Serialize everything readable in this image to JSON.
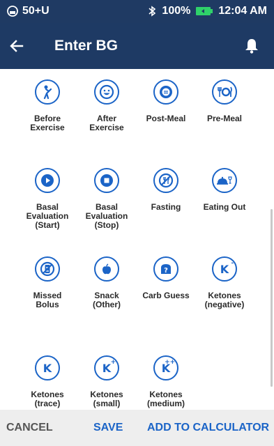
{
  "status_bar": {
    "carrier": "50+U",
    "battery_percent": "100%",
    "time": "12:04 AM"
  },
  "header": {
    "title": "Enter BG"
  },
  "tags": [
    {
      "label": "Before\nExercise",
      "icon": "exercise-icon"
    },
    {
      "label": "After\nExercise",
      "icon": "happy-face-icon"
    },
    {
      "label": "Post-Meal",
      "icon": "empty-plate-icon"
    },
    {
      "label": "Pre-Meal",
      "icon": "utensils-plate-icon"
    },
    {
      "label": "Basal\nEvaluation\n(Start)",
      "icon": "play-icon"
    },
    {
      "label": "Basal\nEvaluation\n(Stop)",
      "icon": "stop-icon"
    },
    {
      "label": "Fasting",
      "icon": "no-food-icon"
    },
    {
      "label": "Eating Out",
      "icon": "cloche-glass-icon"
    },
    {
      "label": "Missed\nBolus",
      "icon": "missed-bolus-icon"
    },
    {
      "label": "Snack\n(Other)",
      "icon": "apple-icon"
    },
    {
      "label": "Carb Guess",
      "icon": "bread-question-icon"
    },
    {
      "label": "Ketones\n(negative)",
      "icon": "ketones-negative-icon",
      "symbol": "K",
      "sup": "-"
    },
    {
      "label": "Ketones\n(trace)",
      "icon": "ketones-trace-icon",
      "symbol": "K",
      "sup": ""
    },
    {
      "label": "Ketones\n(small)",
      "icon": "ketones-small-icon",
      "symbol": "K",
      "sup": "+"
    },
    {
      "label": "Ketones\n(medium)",
      "icon": "ketones-medium-icon",
      "symbol": "K",
      "sup": "++"
    }
  ],
  "footer": {
    "cancel": "CANCEL",
    "save": "SAVE",
    "add_to_calculator": "ADD TO CALCULATOR"
  },
  "colors": {
    "header": "#1e3a64",
    "accent": "#1b64c7"
  }
}
